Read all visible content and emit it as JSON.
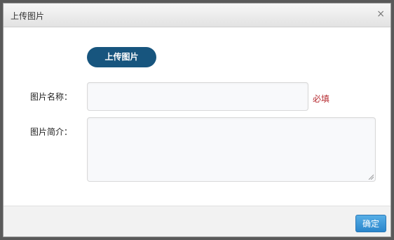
{
  "dialog": {
    "title": "上传图片",
    "close_symbol": "×"
  },
  "upload_button": {
    "label": "上传图片"
  },
  "form": {
    "name_label": "图片名称：",
    "name_value": "",
    "required_text": "必填",
    "description_label": "图片简介：",
    "description_value": ""
  },
  "footer": {
    "confirm_label": "确定"
  },
  "colors": {
    "upload_button": "#17557e",
    "required_text": "#b5282e",
    "confirm_button": "#2a86cc"
  },
  "icons": {
    "close": "close-icon",
    "resize": "resize-grip-icon"
  }
}
